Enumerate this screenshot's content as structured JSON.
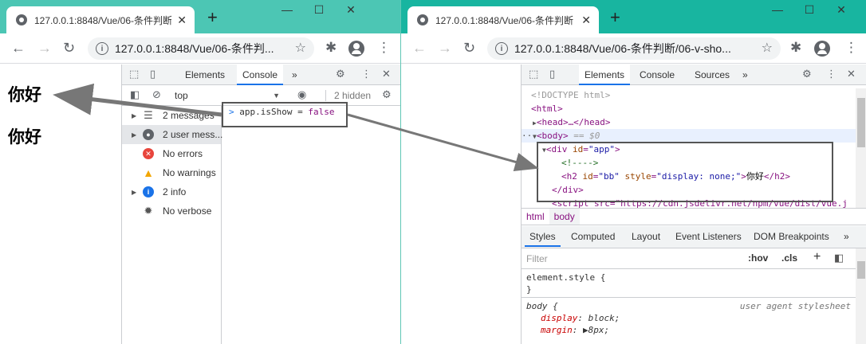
{
  "left": {
    "tab_title": "127.0.0.1:8848/Vue/06-条件判断",
    "url": "127.0.0.1:8848/Vue/06-条件判...",
    "page_headings": [
      "你好",
      "你好"
    ],
    "devtools": {
      "tabs": [
        "Elements",
        "Console"
      ],
      "more": "»",
      "context": "top",
      "hidden_count": "2 hidden",
      "sidebar": [
        {
          "label": "2 messages",
          "icon": "list-icon",
          "expandable": true,
          "selected": false
        },
        {
          "label": "2 user mess...",
          "icon": "user-icon",
          "expandable": true,
          "selected": true
        },
        {
          "label": "No errors",
          "icon": "error-icon",
          "expandable": false,
          "selected": false
        },
        {
          "label": "No warnings",
          "icon": "warning-icon",
          "expandable": false,
          "selected": false
        },
        {
          "label": "2 info",
          "icon": "info-icon",
          "expandable": true,
          "selected": false
        },
        {
          "label": "No verbose",
          "icon": "bug-icon",
          "expandable": false,
          "selected": false
        }
      ],
      "console_prompt": ">",
      "console_code": "app.isShow",
      "console_op": "=",
      "console_value": "false"
    }
  },
  "right": {
    "tab_title": "127.0.0.1:8848/Vue/06-条件判断",
    "url": "127.0.0.1:8848/Vue/06-条件判断/06-v-sho...",
    "devtools": {
      "tabs": [
        "Elements",
        "Console",
        "Sources"
      ],
      "more": "»",
      "dom": {
        "doctype": "<!DOCTYPE html>",
        "html_open": "<html>",
        "head": "<head>…</head>",
        "body_open": "<body>",
        "body_suffix": " == $0",
        "div_open_tag": "div",
        "div_id_attr": "id",
        "div_id_val": "\"app\"",
        "comment": "<!---->",
        "h2_tag": "h2",
        "h2_id_attr": "id",
        "h2_id_val": "\"bb\"",
        "h2_style_attr": "style",
        "h2_style_val": "\"display: none;\"",
        "h2_text": "你好",
        "div_close": "</div>",
        "script_line": "<script src=\"https://cdn.jsdelivr.net/npm/vue/dist/vue.j"
      },
      "breadcrumbs": [
        "html",
        "body"
      ],
      "style_tabs": [
        "Styles",
        "Computed",
        "Layout",
        "Event Listeners",
        "DOM Breakpoints"
      ],
      "filter_placeholder": "Filter",
      "hov": ":hov",
      "cls": ".cls",
      "element_style": "element.style {",
      "close_brace": "}",
      "body_selector": "body {",
      "ua_label": "user agent stylesheet",
      "prop1_name": "display",
      "prop1_val": "block;",
      "prop2_name": "margin",
      "prop2_val": "8px;"
    }
  },
  "colors": {
    "tabstrip_left": "#4cc6b4",
    "tabstrip_right": "#18b5a0",
    "accent": "#1a73e8"
  }
}
